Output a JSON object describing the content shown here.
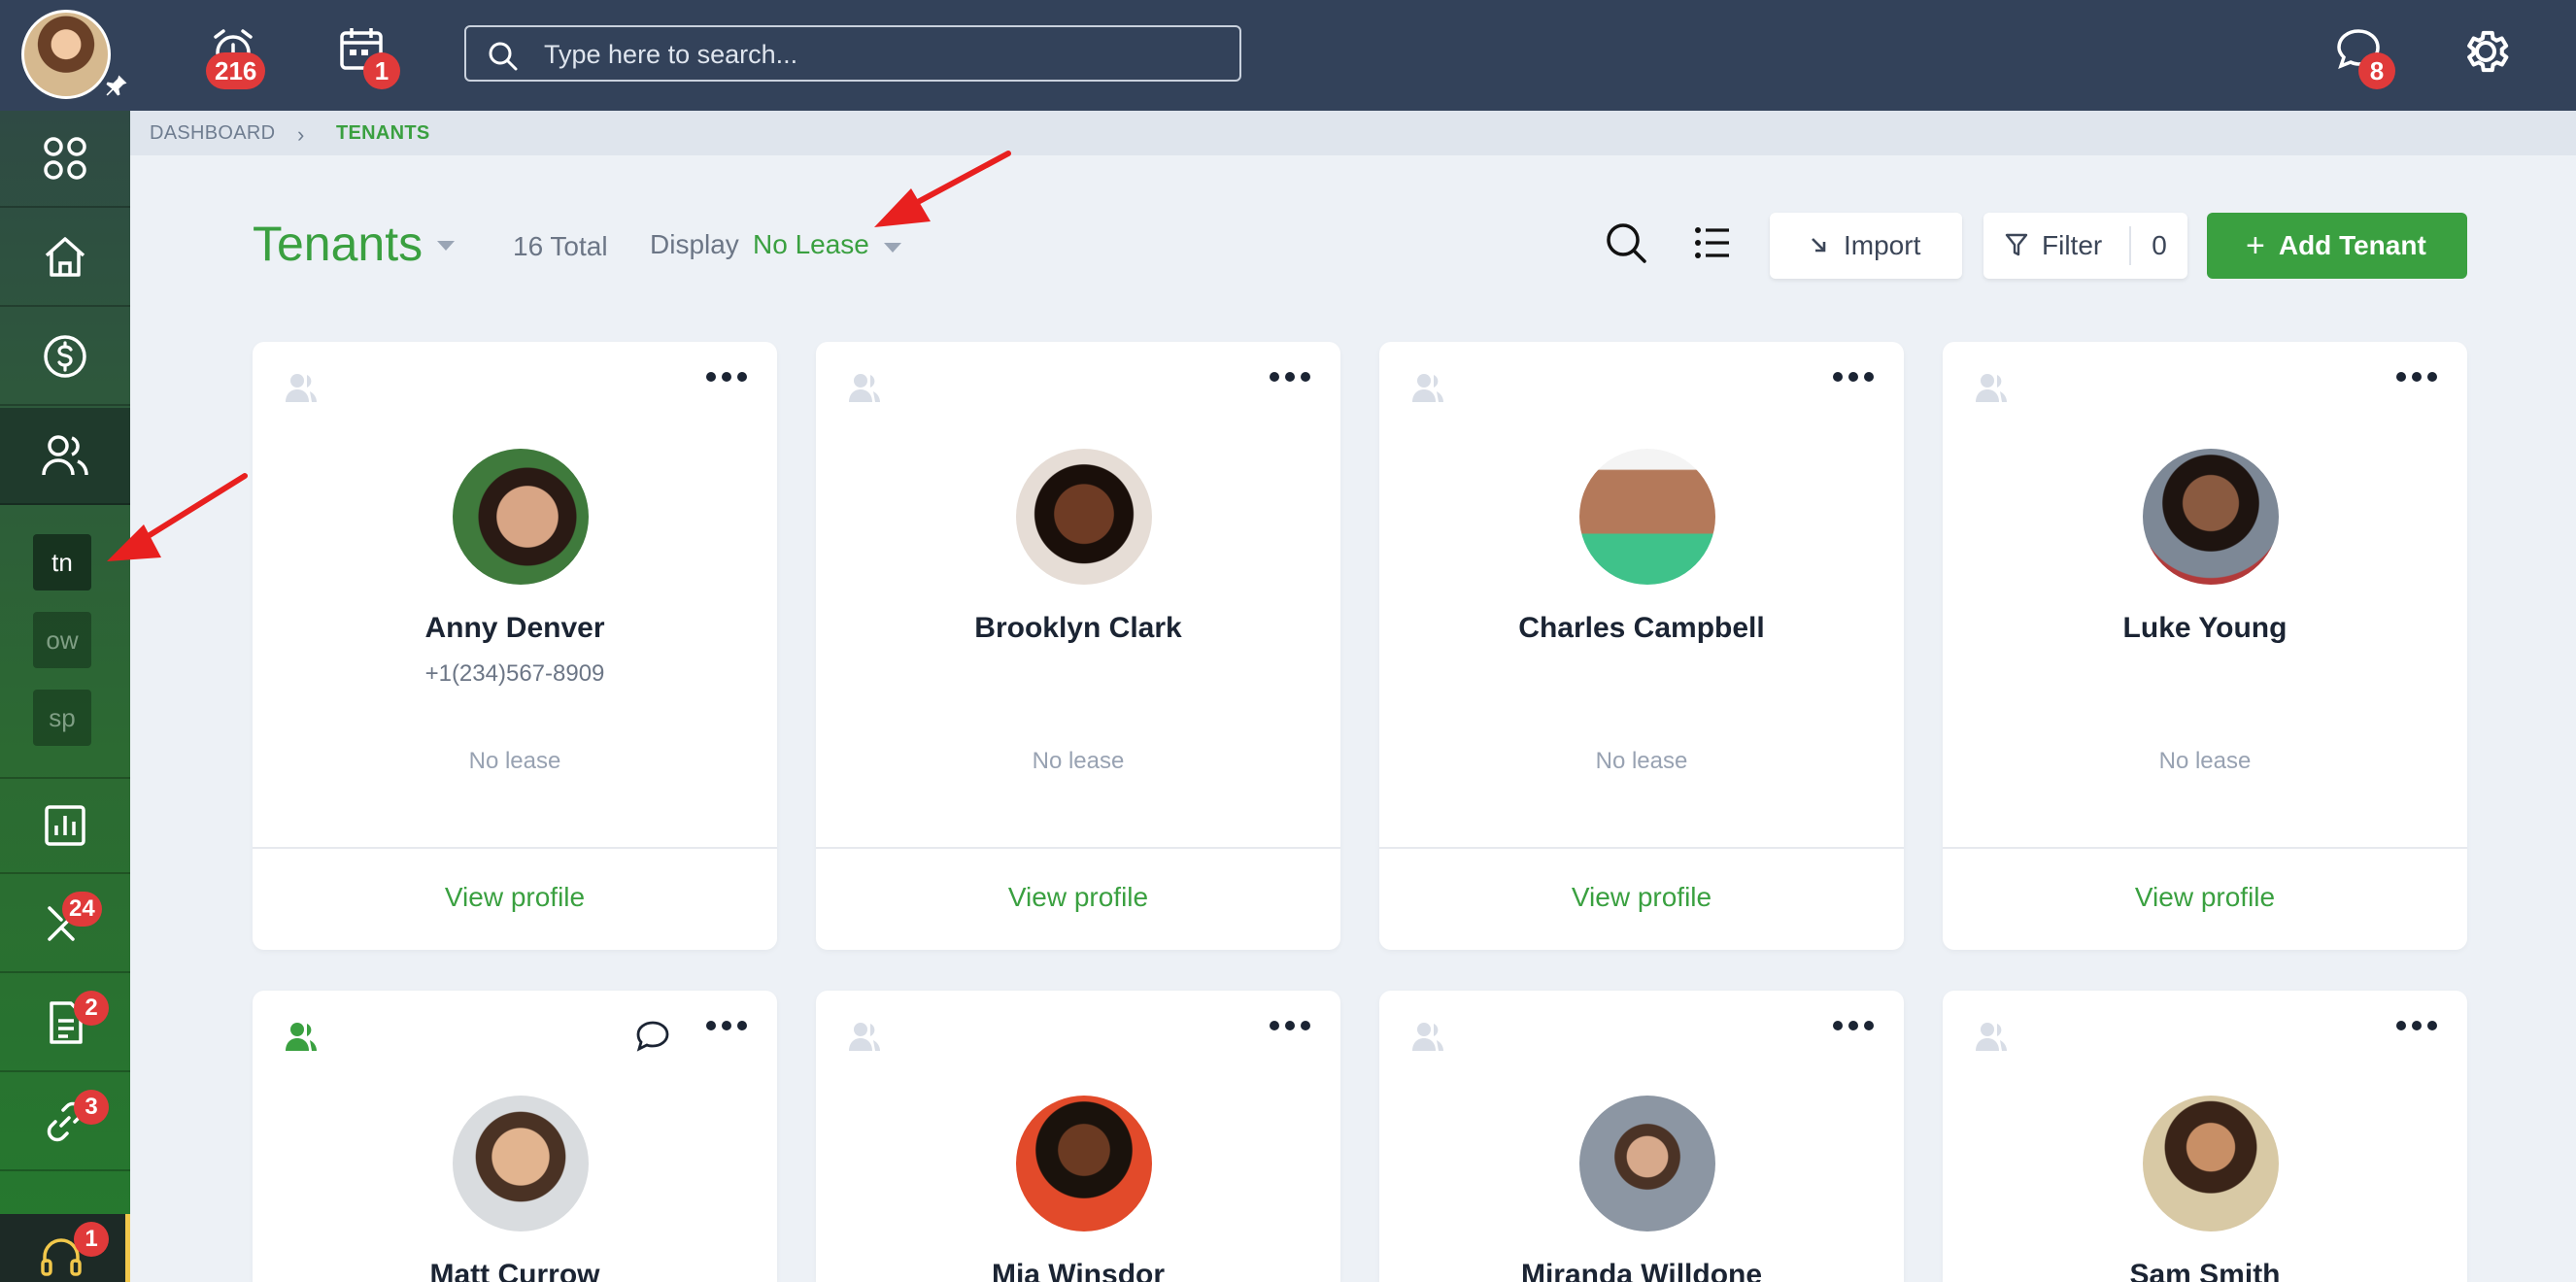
{
  "topbar": {
    "notifications_count": "216",
    "calendar_count": "1",
    "search_placeholder": "Type here to search...",
    "messages_count": "8"
  },
  "sidebar": {
    "sub_items": [
      "tn",
      "ow",
      "sp"
    ],
    "maintenance_count": "24",
    "documents_count": "2",
    "connections_count": "3",
    "support_count": "1"
  },
  "breadcrumb": {
    "root": "DASHBOARD",
    "current": "TENANTS"
  },
  "header": {
    "title": "Tenants",
    "total": "16 Total",
    "display_label": "Display",
    "display_value": "No Lease",
    "import_label": "Import",
    "filter_label": "Filter",
    "filter_count": "0",
    "add_label": "Add Tenant"
  },
  "tenants": [
    {
      "name": "Anny Denver",
      "phone": "+1(234)567-8909",
      "lease": "No lease",
      "view": "View profile"
    },
    {
      "name": "Brooklyn Clark",
      "phone": "",
      "lease": "No lease",
      "view": "View profile"
    },
    {
      "name": "Charles Campbell",
      "phone": "",
      "lease": "No lease",
      "view": "View profile"
    },
    {
      "name": "Luke Young",
      "phone": "",
      "lease": "No lease",
      "view": "View profile"
    },
    {
      "name": "Matt Currow"
    },
    {
      "name": "Mia Winsdor"
    },
    {
      "name": "Miranda Willdone"
    },
    {
      "name": "Sam Smith"
    }
  ],
  "colors": {
    "accent": "#3aa040",
    "topbar": "#33425a",
    "badge": "#e03a3a",
    "annotation": "#e8201f"
  }
}
